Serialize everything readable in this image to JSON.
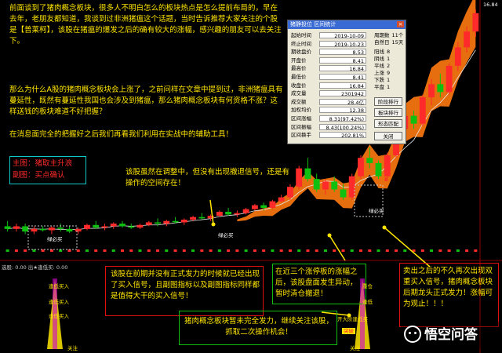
{
  "notes": {
    "intro": "前面谈到了猪肉概念板块，很多人不明白怎么的板块热点是怎么提前布局的，早在去年，老朋友都知道，我谈到过非洲猪瘟这个话题，当时告诉推荐大家关注的个股是【普莱柯】，该股在猪瘟的爆发之后的确有较大的涨幅，感兴趣的朋友可以去关注下。",
    "question": "那么为什么A股的猪肉概念板块会上涨了，之前问样在文章中提到过，非洲猪瘟具有蔓延性，既然有蔓延性我国也会涉及到猪瘟，那么猪肉概念板块有何资格不涨？这样送钱的板块难道不好把握？",
    "tools": "在消息面完全的把握好之后我们再看我们利用在实战中的辅助工具！",
    "legend_main": "主图：猪取主升浪",
    "legend_sub": "副图：买点确认",
    "adjust": "该股虽然在调整中，但没有出现撤退信号，还是有操作的空间存在！",
    "early": "该股在前期并没有正式发力的时候就已经出现了买入信号，且副图指标以及副图指标同样都是值得大干的买入信号！",
    "limitup": "在近三个涨停板的涨幅之后，该股盘面发生异动，暂时清仓撤退！",
    "rebound": "卖出之后的不久再次出现双重买入信号，猪肉概念板块后期龙头正式发力！涨幅可为观止！！！",
    "follow": "猪肉概念板块暂未完全发力，继续关注该股，抓取二次操作机会！"
  },
  "dialog": {
    "title": "猪静投位 区间统计",
    "close": "×",
    "rows": [
      {
        "label": "起始时间",
        "value": "2019-10-09"
      },
      {
        "label": "终止时间",
        "value": "2019-10-23"
      },
      {
        "label": "期收盘价",
        "value": "8.53"
      },
      {
        "label": "开盘价",
        "value": "8.41"
      },
      {
        "label": "最高价",
        "value": "16.84"
      },
      {
        "label": "最低价",
        "value": "8.41"
      },
      {
        "label": "收盘价",
        "value": "16.84"
      },
      {
        "label": "成交量",
        "value": "2301942"
      },
      {
        "label": "成交额",
        "value": "28.4亿"
      },
      {
        "label": "加权均价",
        "value": "12.38"
      },
      {
        "label": "区间涨幅",
        "value": "8.31(97.42%)"
      },
      {
        "label": "区间振幅",
        "value": "8.43(100.24%)"
      },
      {
        "label": "区间换手",
        "value": "202.81%"
      }
    ],
    "side": [
      {
        "label": "周期数",
        "value": "11个"
      },
      {
        "label": "自然日",
        "value": "15天"
      },
      {
        "label": "阳线",
        "value": "8"
      },
      {
        "label": "阴线",
        "value": "1"
      },
      {
        "label": "平线",
        "value": "2"
      },
      {
        "label": "上涨",
        "value": "9"
      },
      {
        "label": "下跌",
        "value": "1"
      },
      {
        "label": "平盘",
        "value": "1"
      }
    ],
    "buttons": [
      "阶段排行",
      "板块排行",
      "形态匹配"
    ],
    "ok": "关闭"
  },
  "chart_labels": {
    "price_top": "16.84",
    "sell_label": "绿必买",
    "buy_mark": "绿必买",
    "mid_label": "B",
    "sub_header": "选股: 0.00  出★逢低买: 0.00",
    "sub_tag_a": "逢低买入",
    "sub_tag_b": "逢低买入",
    "sub_tag_c": "逢低买入",
    "sub_tag_d": "关注",
    "sub_tag_e": "关注",
    "sub_tag_f": "开大阶逢低买",
    "sub_tag_g": "突破",
    "sub_tag_h": "重仓",
    "sub_tag_i": "逢低"
  },
  "watermark": "悟空问答",
  "colors": {
    "bg": "#000000",
    "up": "#ff2a2a",
    "down": "#10c010",
    "band": "#ff7a10",
    "yellow": "#ffe500"
  },
  "chart_data": {
    "type": "candlestick",
    "note": "Approximate daily candles, old to new",
    "candles": [
      {
        "o": 8.6,
        "h": 8.8,
        "l": 8.4,
        "c": 8.5
      },
      {
        "o": 8.5,
        "h": 8.7,
        "l": 8.4,
        "c": 8.6
      },
      {
        "o": 8.6,
        "h": 8.7,
        "l": 8.3,
        "c": 8.4
      },
      {
        "o": 8.4,
        "h": 8.6,
        "l": 8.3,
        "c": 8.5
      },
      {
        "o": 8.5,
        "h": 8.6,
        "l": 8.4,
        "c": 8.45
      },
      {
        "o": 8.45,
        "h": 8.6,
        "l": 8.3,
        "c": 8.55
      },
      {
        "o": 8.55,
        "h": 8.7,
        "l": 8.4,
        "c": 8.5
      },
      {
        "o": 8.5,
        "h": 8.6,
        "l": 8.35,
        "c": 8.4
      },
      {
        "o": 8.4,
        "h": 8.55,
        "l": 8.3,
        "c": 8.5
      },
      {
        "o": 8.5,
        "h": 8.7,
        "l": 8.45,
        "c": 8.65
      },
      {
        "o": 8.65,
        "h": 8.8,
        "l": 8.5,
        "c": 8.55
      },
      {
        "o": 8.55,
        "h": 8.7,
        "l": 8.45,
        "c": 8.6
      },
      {
        "o": 8.6,
        "h": 8.75,
        "l": 8.5,
        "c": 8.7
      },
      {
        "o": 8.7,
        "h": 8.8,
        "l": 8.55,
        "c": 8.6
      },
      {
        "o": 8.6,
        "h": 8.7,
        "l": 8.5,
        "c": 8.55
      },
      {
        "o": 8.55,
        "h": 8.7,
        "l": 8.5,
        "c": 8.65
      },
      {
        "o": 8.65,
        "h": 8.8,
        "l": 8.6,
        "c": 8.75
      },
      {
        "o": 8.75,
        "h": 8.9,
        "l": 8.6,
        "c": 8.7
      },
      {
        "o": 8.7,
        "h": 8.85,
        "l": 8.6,
        "c": 8.8
      },
      {
        "o": 8.8,
        "h": 8.95,
        "l": 8.7,
        "c": 8.75
      },
      {
        "o": 8.75,
        "h": 8.9,
        "l": 8.65,
        "c": 8.85
      },
      {
        "o": 8.85,
        "h": 9.0,
        "l": 8.8,
        "c": 8.95
      },
      {
        "o": 8.95,
        "h": 9.1,
        "l": 8.85,
        "c": 8.9
      },
      {
        "o": 8.9,
        "h": 9.05,
        "l": 8.8,
        "c": 9.0
      },
      {
        "o": 9.0,
        "h": 9.2,
        "l": 8.95,
        "c": 9.15
      },
      {
        "o": 9.15,
        "h": 9.3,
        "l": 9.0,
        "c": 9.05
      },
      {
        "o": 9.05,
        "h": 9.2,
        "l": 8.95,
        "c": 9.1
      },
      {
        "o": 9.1,
        "h": 9.3,
        "l": 9.05,
        "c": 9.25
      },
      {
        "o": 9.25,
        "h": 9.45,
        "l": 9.2,
        "c": 9.4
      },
      {
        "o": 9.4,
        "h": 9.5,
        "l": 9.2,
        "c": 9.3
      },
      {
        "o": 9.3,
        "h": 9.6,
        "l": 9.25,
        "c": 9.55
      },
      {
        "o": 9.55,
        "h": 9.8,
        "l": 9.5,
        "c": 9.7
      },
      {
        "o": 9.7,
        "h": 10.2,
        "l": 9.6,
        "c": 10.1
      },
      {
        "o": 10.1,
        "h": 10.9,
        "l": 10.0,
        "c": 10.8
      },
      {
        "o": 10.8,
        "h": 11.2,
        "l": 10.3,
        "c": 10.4
      },
      {
        "o": 10.4,
        "h": 10.6,
        "l": 9.9,
        "c": 10.0
      },
      {
        "o": 10.0,
        "h": 10.4,
        "l": 9.8,
        "c": 10.3
      },
      {
        "o": 10.3,
        "h": 10.5,
        "l": 9.9,
        "c": 10.0
      },
      {
        "o": 10.0,
        "h": 10.2,
        "l": 9.6,
        "c": 9.7
      },
      {
        "o": 9.7,
        "h": 10.6,
        "l": 9.6,
        "c": 10.5
      },
      {
        "o": 10.5,
        "h": 11.3,
        "l": 10.4,
        "c": 11.2
      },
      {
        "o": 11.2,
        "h": 11.6,
        "l": 10.8,
        "c": 11.0
      },
      {
        "o": 11.0,
        "h": 11.1,
        "l": 10.4,
        "c": 10.5
      },
      {
        "o": 10.5,
        "h": 11.4,
        "l": 10.4,
        "c": 11.3
      },
      {
        "o": 11.3,
        "h": 12.4,
        "l": 11.2,
        "c": 12.3
      },
      {
        "o": 12.3,
        "h": 13.0,
        "l": 12.0,
        "c": 12.8
      },
      {
        "o": 12.8,
        "h": 13.0,
        "l": 12.3,
        "c": 12.5
      },
      {
        "o": 12.5,
        "h": 13.6,
        "l": 12.4,
        "c": 13.5
      },
      {
        "o": 13.5,
        "h": 14.2,
        "l": 13.2,
        "c": 14.0
      },
      {
        "o": 14.0,
        "h": 14.4,
        "l": 13.5,
        "c": 13.7
      },
      {
        "o": 13.7,
        "h": 14.8,
        "l": 13.6,
        "c": 14.7
      },
      {
        "o": 14.7,
        "h": 15.6,
        "l": 14.5,
        "c": 15.4
      },
      {
        "o": 15.4,
        "h": 16.2,
        "l": 15.2,
        "c": 16.0
      },
      {
        "o": 16.0,
        "h": 16.84,
        "l": 15.8,
        "c": 16.7
      }
    ],
    "ylim": [
      7.6,
      17.2
    ],
    "sub_bars": [
      0,
      0,
      0,
      0,
      0,
      0,
      0,
      0,
      0,
      0,
      0,
      0,
      0,
      0,
      0,
      0,
      0,
      0,
      0,
      0,
      0,
      0,
      0,
      0,
      0,
      0,
      0,
      0,
      0,
      0,
      0,
      0,
      0,
      0,
      0,
      0,
      0,
      0,
      0,
      0,
      0,
      0,
      0,
      0,
      0,
      0,
      0,
      0,
      0,
      0,
      0,
      0,
      0,
      0
    ]
  }
}
